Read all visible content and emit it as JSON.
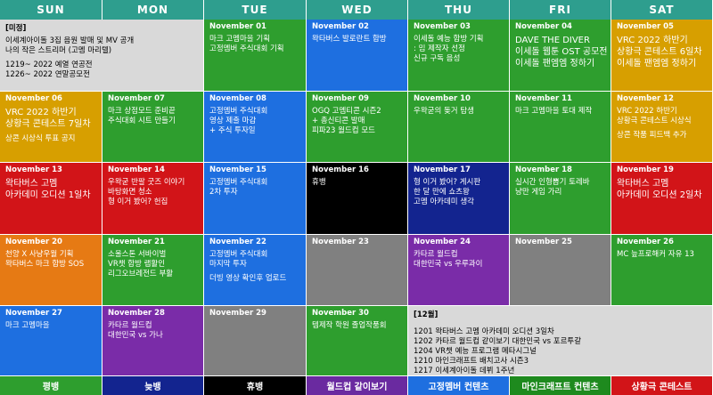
{
  "weekdays": [
    "SUN",
    "MON",
    "TUE",
    "WED",
    "THU",
    "FRI",
    "SAT"
  ],
  "colors": {
    "header": "#2e9e8e",
    "green": "#2e9e2e",
    "blue": "#1e6fe0",
    "red": "#d21418",
    "orange": "#e67a14",
    "yellow": "#d79f00",
    "purple": "#7a2ca8",
    "gray": "#808080",
    "navy": "#13248f",
    "black": "#000000",
    "lightgray": "#d9d9d9",
    "darkgreen": "#1e8a1e",
    "darkpurple": "#6a2aa0"
  },
  "cells": [
    {
      "date": "[미정]",
      "color": "lightgray",
      "text_dark": true,
      "lines": [
        {
          "t": "이세계아이돌 3집 음원 발매 및 MV 공개"
        },
        {
          "t": "나의 작은 스트리머 (고멤 마리텔)"
        },
        {
          "t": ""
        },
        {
          "t": "1219~   2022 예열 연공전"
        },
        {
          "t": "1226~   2022 연말공모전"
        }
      ]
    },
    {
      "date": "November 01",
      "color": "green",
      "lines": [
        {
          "t": "마크 고멤마을 기획"
        },
        {
          "t": "고정멤버 주식대회 기획"
        }
      ]
    },
    {
      "date": "November 02",
      "color": "blue",
      "lines": [
        {
          "t": "왁타버스 발로란트 합방"
        }
      ]
    },
    {
      "date": "November 03",
      "color": "green",
      "lines": [
        {
          "t": "이세돌 예능 합방 기획"
        },
        {
          "t": ": 밈 제작자 선정"
        },
        {
          "t": "신규 구독 음성"
        }
      ]
    },
    {
      "date": "November 04",
      "color": "green",
      "lines": [
        {
          "t": "DAVE THE DIVER",
          "big": true
        },
        {
          "t": "이세돌 웹툰 OST 공모전",
          "big": true
        },
        {
          "t": "이세돌 팬엠엠 정하기",
          "big": true
        }
      ]
    },
    {
      "date": "November 05",
      "color": "yellow",
      "lines": [
        {
          "t": "VRC 2022 하반기",
          "big": true
        },
        {
          "t": "상황극 콘테스트 6일차",
          "big": true
        },
        {
          "t": "이세돌 팬엠엠 정하기",
          "big": true
        }
      ]
    },
    {
      "date": "November 06",
      "color": "yellow",
      "lines": [
        {
          "t": "VRC 2022 하반기",
          "big": true
        },
        {
          "t": "상황극 콘테스트 7일차",
          "big": true
        },
        {
          "t": ""
        },
        {
          "t": "상콘 시상식 투표 공지"
        }
      ]
    },
    {
      "date": "November 07",
      "color": "green",
      "lines": [
        {
          "t": "마크 상점모드 준비끝"
        },
        {
          "t": "주식대회 시트 만들기"
        }
      ]
    },
    {
      "date": "November 08",
      "color": "blue",
      "lines": [
        {
          "t": "고정멤버 주식대회"
        },
        {
          "t": "영상 제출 마감"
        },
        {
          "t": "+ 주식 투자일"
        }
      ]
    },
    {
      "date": "November 09",
      "color": "green",
      "lines": [
        {
          "t": "OGQ 고멤티콘 시즌2"
        },
        {
          "t": "+ 총신티콘 발매"
        },
        {
          "t": "피파23 월드컵 모드"
        }
      ]
    },
    {
      "date": "November 10",
      "color": "green",
      "lines": [
        {
          "t": "우왁굳의 돚거 탐생"
        }
      ]
    },
    {
      "date": "November 11",
      "color": "green",
      "lines": [
        {
          "t": "마크 고멤마을 토대 제작"
        }
      ]
    },
    {
      "date": "November 12",
      "color": "yellow",
      "lines": [
        {
          "t": "VRC 2022 하반기"
        },
        {
          "t": "상황극 콘테스트 시상식"
        },
        {
          "t": ""
        },
        {
          "t": "상콘 작품 피드백 추가"
        }
      ]
    },
    {
      "date": "November 13",
      "color": "red",
      "lines": [
        {
          "t": "왁타버스 고멤",
          "big": true
        },
        {
          "t": "아카데미 오디션 1일차",
          "big": true
        }
      ]
    },
    {
      "date": "November 14",
      "color": "red",
      "lines": [
        {
          "t": "우왁굳 반팔 굿즈 이야기"
        },
        {
          "t": "바탕화면 청소"
        },
        {
          "t": "형 이거 봤어? 헌집"
        }
      ]
    },
    {
      "date": "November 15",
      "color": "blue",
      "lines": [
        {
          "t": "고정멤버 주식대회"
        },
        {
          "t": "2차 투자"
        }
      ]
    },
    {
      "date": "November 16",
      "color": "black",
      "lines": [
        {
          "t": "휴뱅"
        }
      ]
    },
    {
      "date": "November 17",
      "color": "navy",
      "lines": [
        {
          "t": "형 이거 봤어? 게시판"
        },
        {
          "t": "한 달 만에 쇼츠왕"
        },
        {
          "t": "고멤 아카데미 생각"
        }
      ]
    },
    {
      "date": "November 18",
      "color": "green",
      "lines": [
        {
          "t": "실시간 인형뽑기 토레바"
        },
        {
          "t": "냥만 게임 가리"
        }
      ]
    },
    {
      "date": "November 19",
      "color": "red",
      "lines": [
        {
          "t": "왁타버스 고멤",
          "big": true
        },
        {
          "t": "아카데미 오디션 2일차",
          "big": true
        }
      ]
    },
    {
      "date": "November 20",
      "color": "orange",
      "lines": [
        {
          "t": "천양 X 사냥우월 기획"
        },
        {
          "t": "왁타버스 마크 합방 SOS"
        }
      ]
    },
    {
      "date": "November 21",
      "color": "green",
      "lines": [
        {
          "t": "소울스톤 서바이벌"
        },
        {
          "t": "VR챗 합방 랩활인"
        },
        {
          "t": "리그오브레전드 부활"
        }
      ]
    },
    {
      "date": "November 22",
      "color": "blue",
      "lines": [
        {
          "t": "고정멤버 주식대회"
        },
        {
          "t": "마지막 투자"
        },
        {
          "t": ""
        },
        {
          "t": "더빙 영상 확인후 업로드"
        }
      ]
    },
    {
      "date": "November 23",
      "color": "gray",
      "lines": []
    },
    {
      "date": "November 24",
      "color": "purple",
      "lines": [
        {
          "t": "카타르 월드컵"
        },
        {
          "t": "대한민국 vs 우루과이"
        }
      ]
    },
    {
      "date": "November 25",
      "color": "gray",
      "lines": []
    },
    {
      "date": "November 26",
      "color": "green",
      "lines": [
        {
          "t": "MC 늪프로해커 자유 13"
        }
      ]
    },
    {
      "date": "November 27",
      "color": "blue",
      "lines": [
        {
          "t": "마크 고멤마을"
        }
      ]
    },
    {
      "date": "November 28",
      "color": "purple",
      "lines": [
        {
          "t": "카타르 월드컵"
        },
        {
          "t": "대한민국 vs 가나"
        }
      ]
    },
    {
      "date": "November 29",
      "color": "gray",
      "lines": []
    },
    {
      "date": "November 30",
      "color": "green",
      "lines": [
        {
          "t": "템제작 학원 졸업작품회"
        }
      ]
    },
    {
      "date": "[12월]",
      "color": "lightgray",
      "text_dark": true,
      "lines": [
        {
          "t": ""
        },
        {
          "t": "1201    왁타버스 고멤 아카데미 오디션 3일차"
        },
        {
          "t": "1202    카타르 월드컵 같이보기 대한민국 vs 포르투갈"
        },
        {
          "t": "1204    VR챗 예능 프로그램 메타시그널"
        },
        {
          "t": "1210    마인크래프트 배치고사 시즌3"
        },
        {
          "t": "1217    이세계아이돌 데뷔 1주년"
        }
      ]
    }
  ],
  "legend": [
    {
      "label": "평뱅",
      "color": "green"
    },
    {
      "label": "늦뱅",
      "color": "navy"
    },
    {
      "label": "휴뱅",
      "color": "black"
    },
    {
      "label": "월드컵 같이보기",
      "color": "darkpurple"
    },
    {
      "label": "고정멤버 컨텐츠",
      "color": "blue"
    },
    {
      "label": "마인크래프트 컨텐츠",
      "color": "darkgreen"
    },
    {
      "label": "상황극 콘테스트",
      "color": "red"
    }
  ]
}
